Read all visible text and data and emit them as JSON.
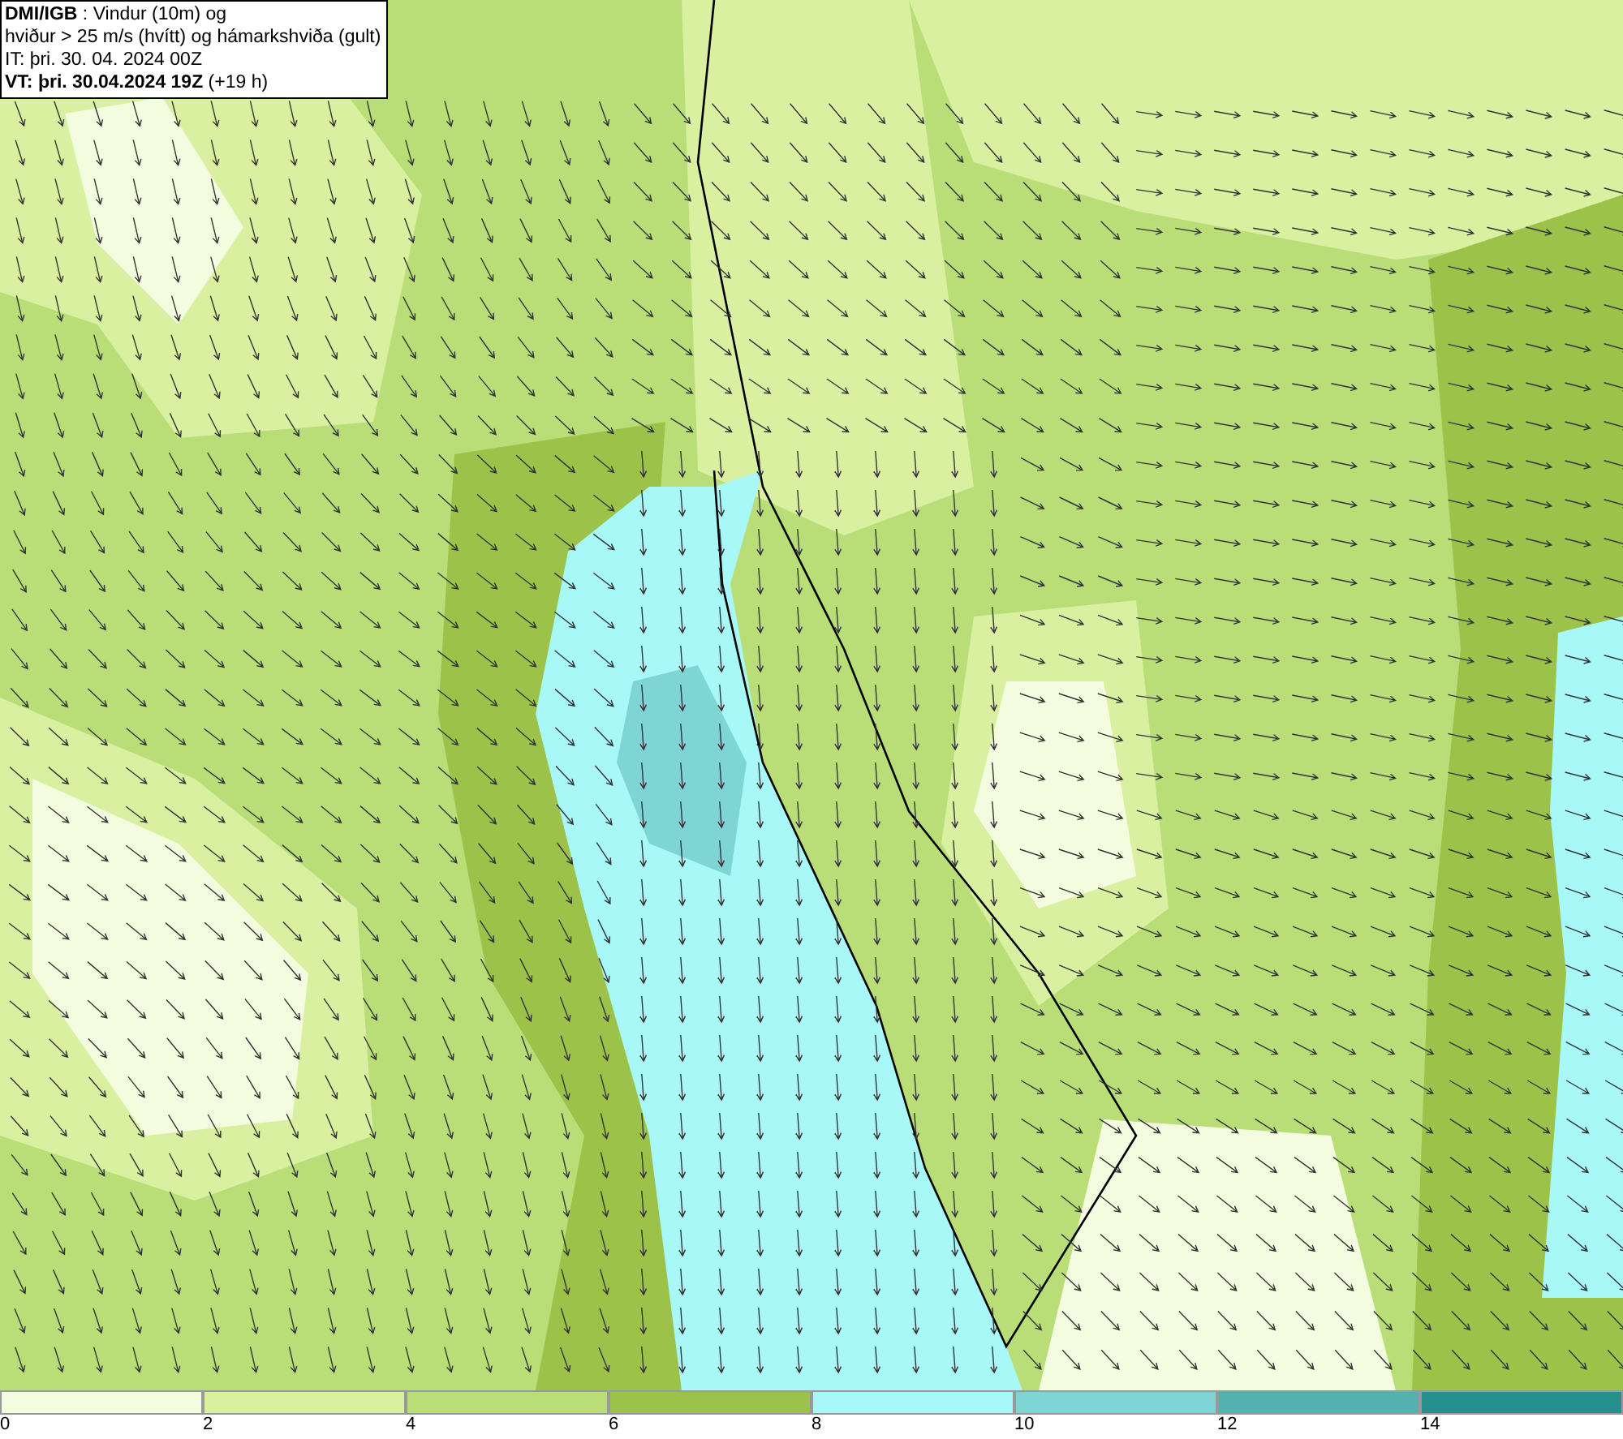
{
  "header": {
    "lines": [
      "**DMI/IGB** : Vindur (10m) og",
      "hviður > 25 m/s (hvítt) og hámarkshviða (gult)",
      "IT: þri. 30. 04. 2024 00Z",
      "**VT: þri. 30.04.2024 19Z** (+19 h)"
    ]
  },
  "legend": [
    {
      "label": "0",
      "color": "#f4fce0"
    },
    {
      "label": "2",
      "color": "#d8f0a0"
    },
    {
      "label": "4",
      "color": "#b9de78"
    },
    {
      "label": "6",
      "color": "#9cc24a"
    },
    {
      "label": "8",
      "color": "#a8f8f8"
    },
    {
      "label": "10",
      "color": "#7fd4d4"
    },
    {
      "label": "12",
      "color": "#55b0b0"
    },
    {
      "label": "14",
      "color": "#25908c"
    }
  ]
}
